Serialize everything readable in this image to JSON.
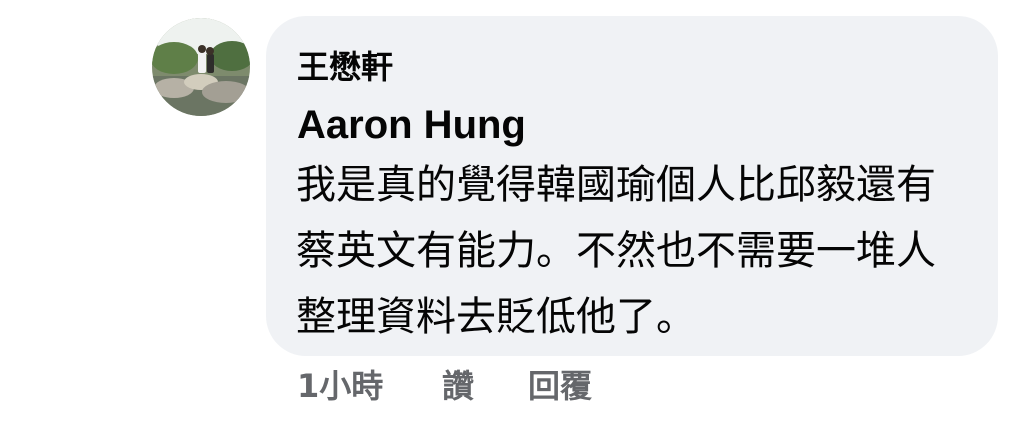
{
  "comment": {
    "avatar": "nature-photo-avatar",
    "author": "王懋軒",
    "reply_to": "Aaron Hung",
    "text_lines": [
      "我是真的覺得韓國瑜個人比邱毅還有",
      "蔡英文有能力。不然也不需要一堆人",
      "整理資料去貶低他了。"
    ],
    "time": "1小時",
    "like_label": "讚",
    "reply_label": "回覆"
  }
}
